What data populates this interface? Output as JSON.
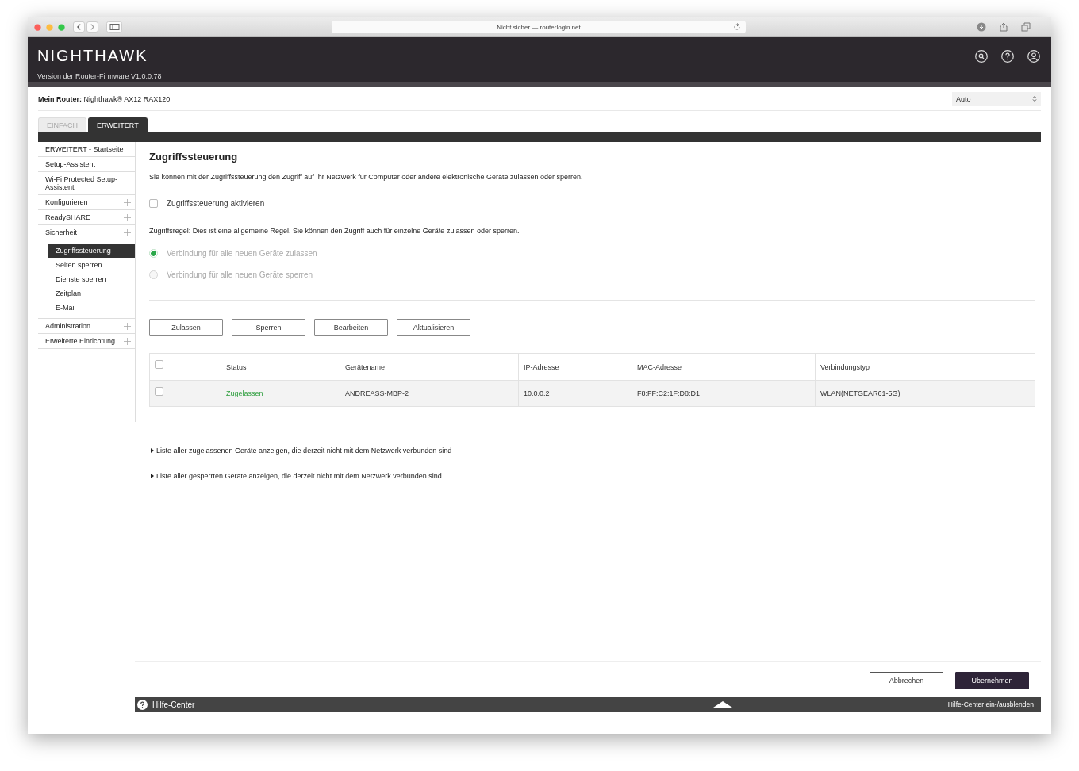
{
  "browser": {
    "address": "Nicht sicher — routerlogin.net"
  },
  "header": {
    "logo": "NIGHTHAWK",
    "firmware": "Version der Router-Firmware V1.0.0.78"
  },
  "router_bar": {
    "label": "**Mein Router:** Nighthawk® AX12 RAX120",
    "language_select": "Auto"
  },
  "tabs": [
    {
      "label": "EINFACH",
      "selected": false
    },
    {
      "label": "ERWEITERT",
      "selected": true
    }
  ],
  "sidebar": {
    "items": [
      {
        "label": "ERWEITERT - Startseite",
        "expandable": false
      },
      {
        "label": "Setup-Assistent",
        "expandable": false
      },
      {
        "label": "Wi-Fi Protected Setup-Assistent",
        "expandable": false
      },
      {
        "label": "Konfigurieren",
        "expandable": true
      },
      {
        "label": "ReadySHARE",
        "expandable": true
      },
      {
        "label": "Sicherheit",
        "expandable": true,
        "children": [
          {
            "label": "Zugriffssteuerung",
            "selected": true
          },
          {
            "label": "Seiten sperren",
            "selected": false
          },
          {
            "label": "Dienste sperren",
            "selected": false
          },
          {
            "label": "Zeitplan",
            "selected": false
          },
          {
            "label": "E-Mail",
            "selected": false
          }
        ]
      },
      {
        "label": "Administration",
        "expandable": true
      },
      {
        "label": "Erweiterte Einrichtung",
        "expandable": true
      }
    ]
  },
  "page": {
    "title": "Zugriffssteuerung",
    "description": "Sie können mit der Zugriffssteuerung den Zugriff auf Ihr Netzwerk für Computer oder andere elektronische Geräte zulassen oder sperren.",
    "enable_checkbox": {
      "label": "Zugriffssteuerung aktivieren",
      "checked": false
    },
    "rule_text": "Zugriffsregel: Dies ist eine allgemeine Regel. Sie können den Zugriff auch für einzelne Geräte zulassen oder sperren.",
    "radios": [
      {
        "label": "Verbindung für alle neuen Geräte zulassen",
        "selected": true,
        "disabled": true
      },
      {
        "label": "Verbindung für alle neuen Geräte sperren",
        "selected": false,
        "disabled": true
      }
    ],
    "buttons": [
      "Zulassen",
      "Sperren",
      "Bearbeiten",
      "Aktualisieren"
    ],
    "table": {
      "header_checked": false,
      "columns": [
        "Status",
        "Gerätename",
        "IP-Adresse",
        "MAC-Adresse",
        "Verbindungstyp"
      ],
      "rows": [
        {
          "checked": false,
          "allowed": true,
          "cells": [
            "Zugelassen",
            "ANDREASS-MBP-2",
            "10.0.0.2",
            "F8:FF:C2:1F:D8:D1",
            "WLAN(NETGEAR61-5G)"
          ]
        }
      ]
    },
    "links": [
      "Liste aller zugelassenen Geräte anzeigen, die derzeit nicht mit dem Netzwerk verbunden sind",
      "Liste aller gesperrten Geräte anzeigen, die derzeit nicht mit dem Netzwerk verbunden sind"
    ]
  },
  "footer_buttons": [
    {
      "label": "Abbrechen",
      "kind": "secondary"
    },
    {
      "label": "Übernehmen",
      "kind": "primary"
    }
  ],
  "help_bar": {
    "label": "Hilfe-Center",
    "toggle_link": "Hilfe-Center ein-/ausblenden"
  }
}
